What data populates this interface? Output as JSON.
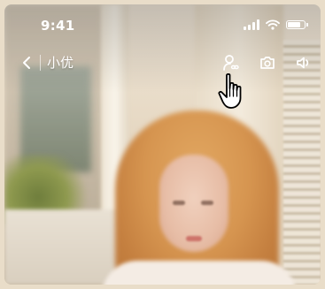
{
  "status_bar": {
    "time": "9:41",
    "signal_icon": "cellular-signal-icon",
    "wifi_icon": "wifi-icon",
    "battery_icon": "battery-icon",
    "battery_level": 0.85
  },
  "nav": {
    "back_icon": "chevron-left-icon",
    "title": "小优",
    "actions": [
      {
        "name": "profile-link-button",
        "icon": "person-link-icon"
      },
      {
        "name": "camera-button",
        "icon": "camera-icon"
      },
      {
        "name": "sound-button",
        "icon": "speaker-icon"
      }
    ]
  },
  "cursor_icon": "hand-pointer-icon",
  "colors": {
    "icon": "#ffffff",
    "hair": "#d69550"
  }
}
